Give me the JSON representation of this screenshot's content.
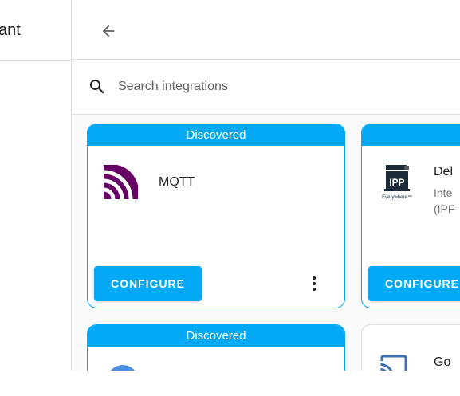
{
  "app": {
    "title_fragment": "ant"
  },
  "search": {
    "placeholder": "Search integrations",
    "value": ""
  },
  "cards": [
    {
      "banner": "Discovered",
      "title": "MQTT",
      "configure_label": "CONFIGURE"
    },
    {
      "banner": "Discovered",
      "title": "Del",
      "subtitle_line1": "Inte",
      "subtitle_line2": "(IPF",
      "configure_label": "CONFIGURE"
    },
    {
      "banner": "Discovered"
    },
    {
      "title": "Go"
    }
  ],
  "colors": {
    "accent": "#03a9f4",
    "mqtt_purple": "#660066",
    "ipp_dark": "#1c2b39"
  }
}
